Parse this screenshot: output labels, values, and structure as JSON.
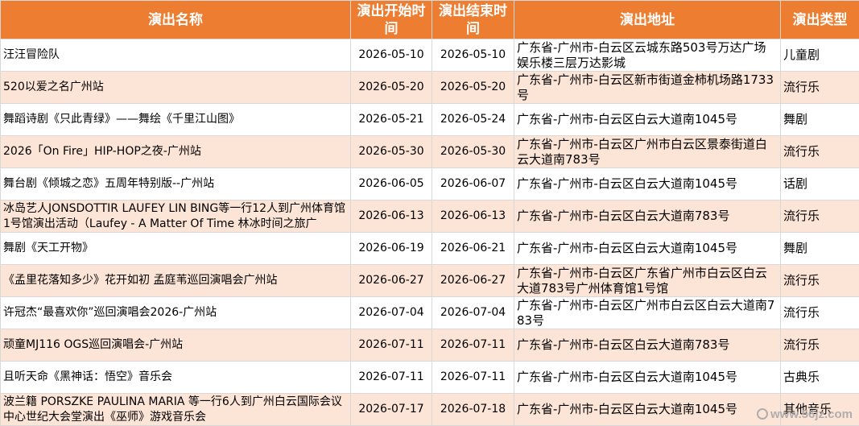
{
  "table": {
    "headers": [
      "演出名称",
      "演出开始时间",
      "演出结束时间",
      "演出地址",
      "演出类型"
    ],
    "rows": [
      [
        "汪汪冒险队",
        "2026-05-10",
        "2026-05-10",
        "广东省-广州市-白云区云城东路503号万达广场娱乐楼三层万达影城",
        "儿童剧"
      ],
      [
        "520以爱之名广州站",
        "2026-05-20",
        "2026-05-20",
        "广东省-广州市-白云区新市街道金柿机场路1733号",
        "流行乐"
      ],
      [
        "舞蹈诗剧《只此青绿》——舞绘《千里江山图》",
        "2026-05-21",
        "2026-05-24",
        "广东省-广州市-白云区白云大道南1045号",
        "舞剧"
      ],
      [
        "2026「On Fire」HIP-HOP之夜-广州站",
        "2026-05-30",
        "2026-05-30",
        "广东省-广州市-白云区广州市白云区景泰街道白云大道南783号",
        "流行乐"
      ],
      [
        "舞台剧《倾城之恋》五周年特别版--广州站",
        "2026-06-05",
        "2026-06-07",
        "广东省-广州市-白云区白云大道南1045号",
        "话剧"
      ],
      [
        "冰岛艺人JONSDOTTIR LAUFEY LIN BING等一行12人到广州体育馆1号馆演出活动（Laufey - A Matter Of Time 林冰时间之旅广",
        "2026-06-13",
        "2026-06-13",
        "广东省-广州市-白云区白云大道南783号",
        "流行乐"
      ],
      [
        "舞剧《天工开物》",
        "2026-06-19",
        "2026-06-21",
        "广东省-广州市-白云区白云大道南1045号",
        "舞剧"
      ],
      [
        "《孟里花落知多少》花开如初 孟庭苇巡回演唱会广州站",
        "2026-06-27",
        "2026-06-27",
        "广东省-广州市-白云区广东省广州市白云区白云大道783号广州体育馆1号馆",
        "流行乐"
      ],
      [
        "许冠杰“最喜欢你”巡回演唱会2026-广州站",
        "2026-07-04",
        "2026-07-04",
        "广东省-广州市-白云区广州市白云区白云大道南783号",
        "流行乐"
      ],
      [
        "顽童MJ116 OGS巡回演唱会-广州站",
        "2026-07-11",
        "2026-07-11",
        "广东省-广州市-白云区白云大道南783号",
        "流行乐"
      ],
      [
        "且听天命《黑神话：悟空》音乐会",
        "2026-07-11",
        "2026-07-11",
        "广东省-广州市-白云区白云大道南1045号",
        "古典乐"
      ],
      [
        "波兰籍 PORSZKE PAULINA MARIA 等一行6人到广州白云国际会议中心世纪大会堂演出《巫师》游戏音乐会",
        "2026-07-17",
        "2026-07-18",
        "广东省-广州市-白云区白云大道南1045号",
        "其他音乐"
      ]
    ]
  },
  "watermark": "www.56jz.com",
  "colors": {
    "header_bg": "#ed7d31",
    "header_text": "#ffffff",
    "stripe": "#fce4d6",
    "border": "#d8d8d8"
  }
}
